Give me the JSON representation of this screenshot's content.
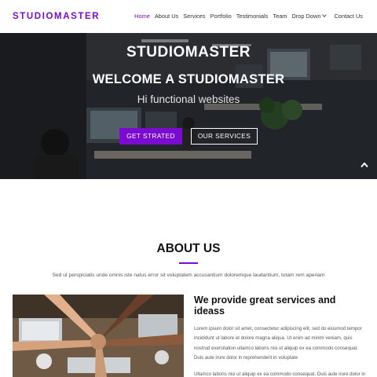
{
  "brand": {
    "name": "STUDIOMASTER",
    "color": "#7b0bd0"
  },
  "nav": {
    "items": [
      "Home",
      "About Us",
      "Services",
      "Portfolio",
      "Testimonials",
      "Team",
      "Drop Down"
    ],
    "contact": "Contact Us",
    "active": "Home"
  },
  "hero": {
    "title": "STUDIOMASTER",
    "heading": "WELCOME A STUDIOMASTER",
    "subheading": "Hi functional websites",
    "primary_button": "GET STRATED",
    "secondary_button": "OUR SERVICES"
  },
  "about": {
    "title": "ABOUT US",
    "description": "Sed ut perspiciatis unde omnis iste natus error sit voluptatem accusantium doloremque laudantium, totam rem aperiam",
    "heading": "We provide great services and ideass",
    "paragraph1": "Lorem ipsum dolor sit amet, consectetur adipiscing elit, sed do eiusmod tempor incididunt ut labore et dolore magna aliqua. Ut enim ad minim veniam, quis nostrud exercitation ullamco laboris nisi ut aliquip ex ea commodo consequat. Duis aute irure dolor in reprehenderit in voluptate",
    "paragraph2": "Ullamco laboris nisi ut aliquip ex ea commodo consequat. Duis aute irure dolor in"
  },
  "icons": [
    "chevron-down-icon",
    "arrow-up-icon"
  ]
}
